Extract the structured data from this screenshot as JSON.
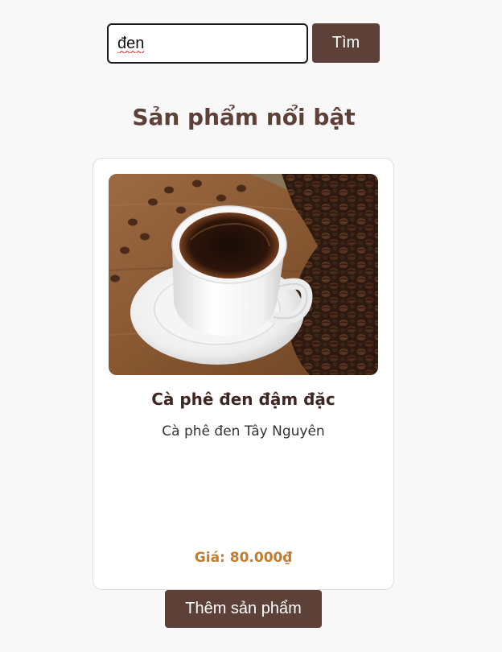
{
  "search": {
    "value": "đen",
    "button_label": "Tìm"
  },
  "section": {
    "title": "Sản phẩm nổi bật"
  },
  "products": [
    {
      "image": "coffee-cup-image",
      "name": "Cà phê đen đậm đặc",
      "description": "Cà phê đen Tây Nguyên",
      "price": "Giá: 80.000₫"
    }
  ],
  "actions": {
    "add_product_label": "Thêm sản phẩm"
  },
  "colors": {
    "brand_brown": "#5d4037",
    "price_accent": "#c77a2e",
    "title_text": "#5d4037",
    "page_background": "#f8f8f8"
  }
}
